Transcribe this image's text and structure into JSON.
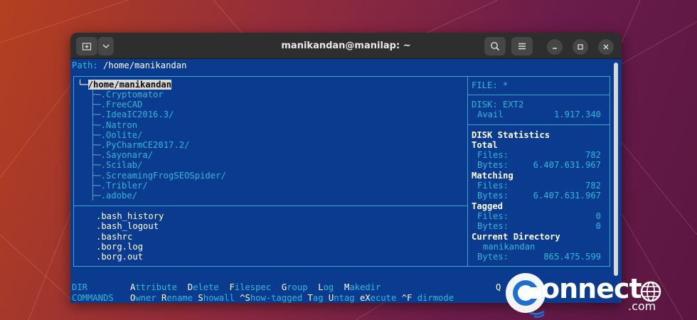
{
  "window": {
    "title": "manikandan@manilap: ~"
  },
  "path": {
    "label": "Path:",
    "value": "/home/manikandan"
  },
  "tree": {
    "root": "/home/manikandan",
    "dirs": [
      ".Cryptomator",
      ".FreeCAD",
      ".IdeaIC2016.3/",
      ".Natron",
      ".Oolite/",
      ".PyCharmCE2017.2/",
      ".Sayonara/",
      ".Scilab/",
      ".ScreamingFrogSEOSpider/",
      ".Tribler/",
      ".adobe/"
    ]
  },
  "files": [
    ".bash_history",
    ".bash_logout",
    ".bashrc",
    ".borg.log",
    ".borg.out"
  ],
  "info": {
    "file_line": "FILE: *",
    "disk_line": "DISK: EXT2",
    "avail_label": "Avail",
    "avail_value": "1.917.340",
    "stats_title": "DISK Statistics",
    "total_title": "Total",
    "total_files_label": "Files:",
    "total_files": "782",
    "total_bytes_label": "Bytes:",
    "total_bytes": "6.407.631.967",
    "matching_title": "Matching",
    "matching_files_label": "Files:",
    "matching_files": "782",
    "matching_bytes_label": "Bytes:",
    "matching_bytes": "6.407.631.967",
    "tagged_title": "Tagged",
    "tagged_files_label": "Files:",
    "tagged_files": "0",
    "tagged_bytes_label": "Bytes:",
    "tagged_bytes": "0",
    "curdir_title": "Current Directory",
    "curdir_name": "manikandan",
    "curdir_bytes_label": "Bytes:",
    "curdir_bytes": "865.475.599"
  },
  "commands": {
    "row1_label": "DIR",
    "row1": [
      {
        "hot": "A",
        "rest": "ttribute"
      },
      {
        "hot": "D",
        "rest": "elete"
      },
      {
        "hot": "F",
        "rest": "ilespec"
      },
      {
        "hot": "G",
        "rest": "roup"
      },
      {
        "hot": "L",
        "rest": "og"
      },
      {
        "hot": "M",
        "rest": "akedir"
      }
    ],
    "row1_tail": "Q",
    "row2_label": "COMMANDS",
    "row2": [
      {
        "hot": "O",
        "rest": "wner"
      },
      {
        "hot": "R",
        "rest": "ename"
      },
      {
        "hot": "S",
        "rest": "howall"
      },
      {
        "hot": "^S",
        "rest": "how-tagged"
      },
      {
        "hot": "T",
        "rest": "ag"
      },
      {
        "hot": "U",
        "rest": "ntag"
      },
      {
        "hot": "eX",
        "rest": "ecute"
      },
      {
        "hot": "^F",
        "rest": " dirmode"
      }
    ]
  },
  "watermark": {
    "text": "onnect",
    "sub": ".com"
  },
  "colors": {
    "terminal_bg": "#0b3b8f",
    "cyan": "#2fb8d6",
    "titlebar": "#2e2e2e"
  }
}
